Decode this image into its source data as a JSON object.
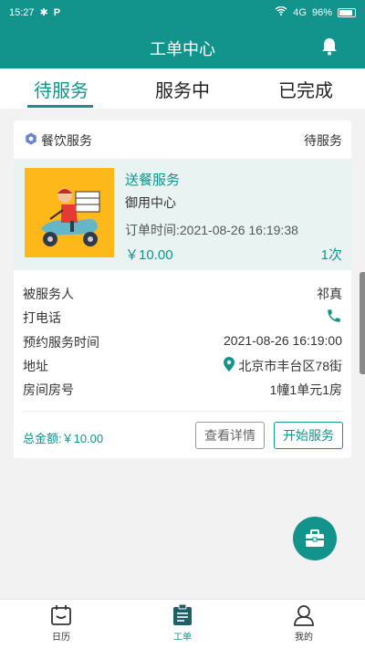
{
  "status_bar": {
    "time": "15:27",
    "signal": "4G",
    "battery_percent": "96%"
  },
  "header": {
    "title": "工单中心"
  },
  "tabs": [
    "待服务",
    "服务中",
    "已完成"
  ],
  "active_tab_index": 0,
  "order": {
    "category": "餐饮服务",
    "status": "待服务",
    "item_title": "送餐服务",
    "item_sub": "御用中心",
    "order_time": "订单时间:2021-08-26 16:19:38",
    "price": "￥10.00",
    "quantity": "1次",
    "details": {
      "recipient_label": "被服务人",
      "recipient": "祁真",
      "call_label": "打电话",
      "appointment_label": "预约服务时间",
      "appointment": "2021-08-26 16:19:00",
      "address_label": "地址",
      "address": "北京市丰台区78街",
      "room_label": "房间房号",
      "room": "1幢1单元1房"
    },
    "total": "总金额:￥10.00",
    "detail_button": "查看详情",
    "start_button": "开始服务"
  },
  "bottom_nav": [
    "日历",
    "工单",
    "我的"
  ],
  "colors": {
    "brand": "#12948c",
    "background": "#f2f2f2",
    "item_bg": "#e9f3f2"
  }
}
